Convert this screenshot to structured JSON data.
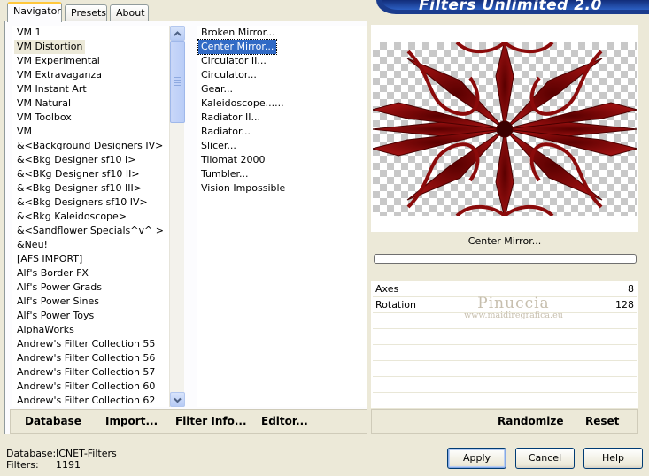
{
  "tabs": [
    {
      "label": "Navigator",
      "active": true
    },
    {
      "label": "Presets",
      "active": false
    },
    {
      "label": "About",
      "active": false
    }
  ],
  "banner": {
    "title": "Filters Unlimited 2.0"
  },
  "categories": {
    "selected_index": 1,
    "items": [
      "VM 1",
      "VM Distortion",
      "VM Experimental",
      "VM Extravaganza",
      "VM Instant Art",
      "VM Natural",
      "VM Toolbox",
      "VM",
      "&<Background Designers IV>",
      "&<Bkg Designer sf10 I>",
      "&<BKg Designer sf10 II>",
      "&<Bkg Designer sf10 III>",
      "&<Bkg Designers sf10 IV>",
      "&<Bkg Kaleidoscope>",
      "&<Sandflower Specials^v^ >",
      "&Neu!",
      "[AFS IMPORT]",
      "Alf's Border FX",
      "Alf's Power Grads",
      "Alf's Power Sines",
      "Alf's Power Toys",
      "AlphaWorks",
      "Andrew's Filter Collection 55",
      "Andrew's Filter Collection 56",
      "Andrew's Filter Collection 57",
      "Andrew's Filter Collection 60",
      "Andrew's Filter Collection 62"
    ]
  },
  "filters": {
    "selected_index": 1,
    "items": [
      "Broken Mirror...",
      "Center Mirror...",
      "Circulator II...",
      "Circulator...",
      "Gear...",
      "Kaleidoscope......",
      "Radiator II...",
      "Radiator...",
      "Slicer...",
      "Tilomat 2000",
      "Tumbler...",
      "Vision Impossible"
    ]
  },
  "left_buttons": {
    "database": "Database",
    "import": "Import...",
    "filter_info": "Filter Info...",
    "editor": "Editor..."
  },
  "current_filter": "Center Mirror...",
  "progress": 0,
  "params": [
    {
      "name": "Axes",
      "value": "8"
    },
    {
      "name": "Rotation",
      "value": "128"
    },
    {
      "name": "",
      "value": ""
    },
    {
      "name": "",
      "value": ""
    },
    {
      "name": "",
      "value": ""
    },
    {
      "name": "",
      "value": ""
    },
    {
      "name": "",
      "value": ""
    },
    {
      "name": "",
      "value": ""
    }
  ],
  "watermark": {
    "line1": "Pinuccia",
    "line2": "www.maidiregrafica.eu"
  },
  "right_buttons": {
    "randomize": "Randomize",
    "reset": "Reset"
  },
  "status": {
    "database_label": "Database:",
    "database_value": "ICNET-Filters",
    "filters_label": "Filters:",
    "filters_value": "1191"
  },
  "dialog_buttons": {
    "apply": "Apply",
    "cancel": "Cancel",
    "help": "Help"
  },
  "colors": {
    "preview_red": "#8b0a0a",
    "selection": "#316ac5",
    "banner": "#1a3b8c"
  },
  "icons": {
    "scroll_up": "chevron-up-icon",
    "scroll_down": "chevron-down-icon"
  }
}
